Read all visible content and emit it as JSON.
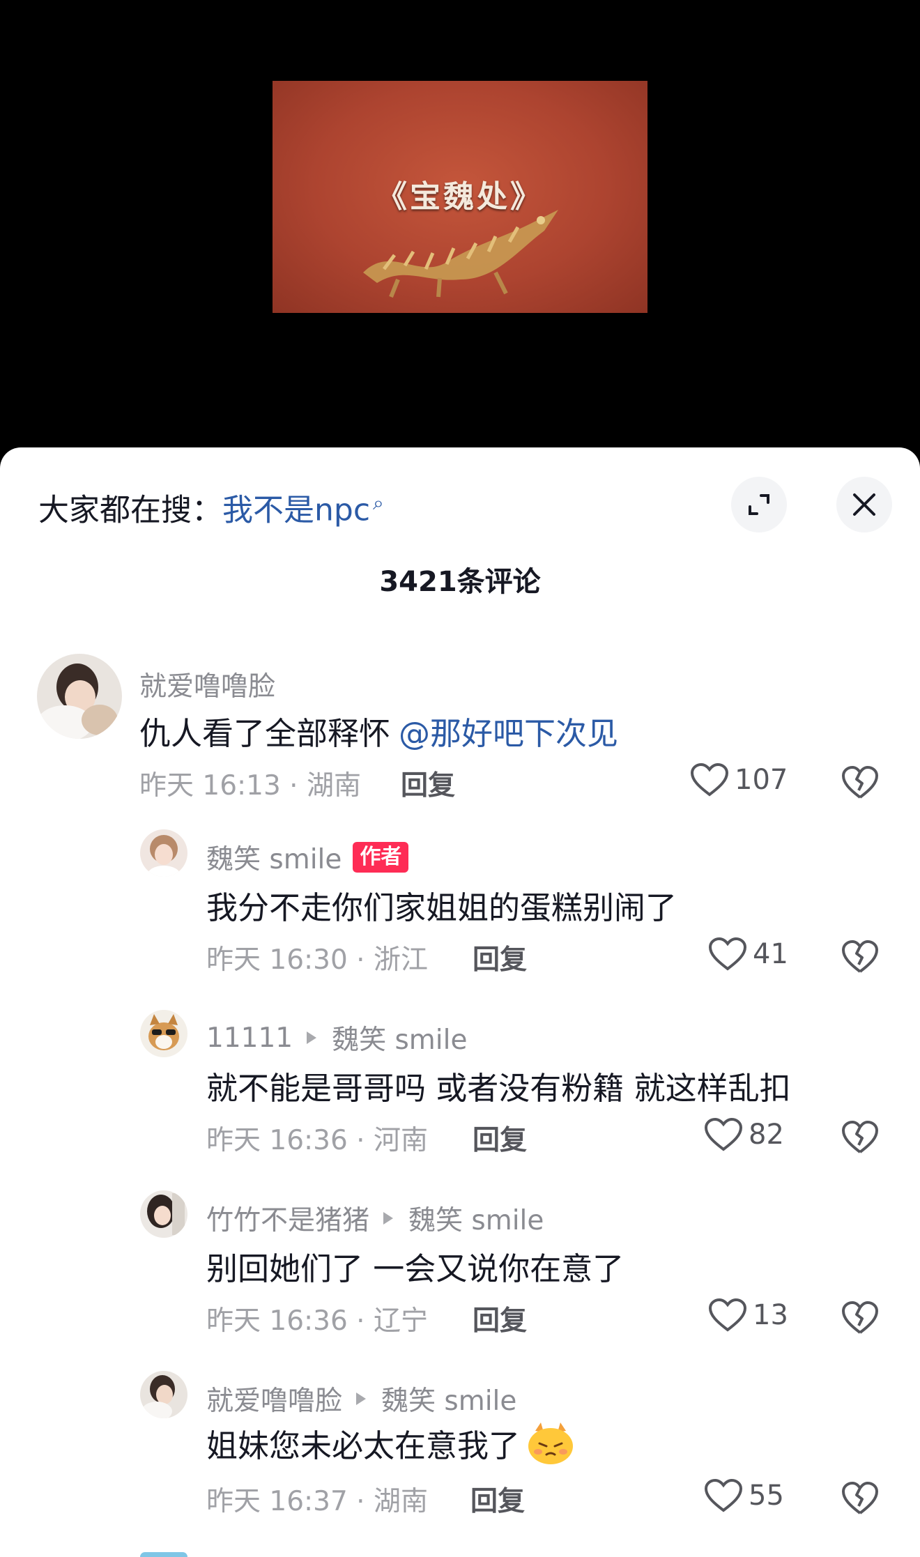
{
  "video": {
    "title": "《宝魏处》"
  },
  "sheet": {
    "search_prefix": "大家都在搜：",
    "search_term": "我不是npc",
    "comment_count": "3421条评论"
  },
  "comments": [
    {
      "username": "就爱噜噜脸",
      "text": "仇人看了全部释怀",
      "mention": "@那好吧下次见",
      "time_location": "昨天 16:13 · 湖南",
      "reply_label": "回复",
      "likes": "107"
    },
    {
      "username": "魏笑 smile",
      "author_tag": "作者",
      "text": "我分不走你们家姐姐的蛋糕别闹了",
      "time_location": "昨天 16:30 · 浙江",
      "reply_label": "回复",
      "likes": "41"
    },
    {
      "username": "11111",
      "reply_to": "魏笑 smile",
      "text": "就不能是哥哥吗 或者没有粉籍 就这样乱扣",
      "time_location": "昨天 16:36 · 河南",
      "reply_label": "回复",
      "likes": "82"
    },
    {
      "username": "竹竹不是猪猪",
      "reply_to": "魏笑 smile",
      "text": "别回她们了 一会又说你在意了",
      "time_location": "昨天 16:36 · 辽宁",
      "reply_label": "回复",
      "likes": "13"
    },
    {
      "username": "就爱噜噜脸",
      "reply_to": "魏笑 smile",
      "text": "姐妹您未必太在意我了",
      "emoji": "pouting-face-emoji",
      "time_location": "昨天 16:37 · 湖南",
      "reply_label": "回复",
      "likes": "55"
    }
  ],
  "colors": {
    "link_blue": "#2b5aa6",
    "author_tag_red": "#fe2c55",
    "thumb_red": "#b4472f"
  }
}
